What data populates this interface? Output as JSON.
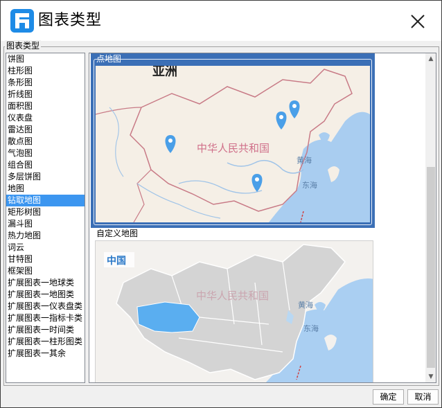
{
  "window": {
    "title": "图表类型",
    "close_icon": "close-icon",
    "logo_icon": "app-logo-icon",
    "accent": "#1e8be6"
  },
  "group": {
    "label": "图表类型"
  },
  "chart_types": [
    {
      "label": "饼图"
    },
    {
      "label": "柱形图"
    },
    {
      "label": "条形图"
    },
    {
      "label": "折线图"
    },
    {
      "label": "面积图"
    },
    {
      "label": "仪表盘"
    },
    {
      "label": "雷达图"
    },
    {
      "label": "散点图"
    },
    {
      "label": "气泡图"
    },
    {
      "label": "组合图"
    },
    {
      "label": "多层饼图"
    },
    {
      "label": "地图"
    },
    {
      "label": "钻取地图"
    },
    {
      "label": "矩形树图"
    },
    {
      "label": "漏斗图"
    },
    {
      "label": "热力地图"
    },
    {
      "label": "词云"
    },
    {
      "label": "甘特图"
    },
    {
      "label": "框架图"
    },
    {
      "label": "扩展图表一地球类"
    },
    {
      "label": "扩展图表一地图类"
    },
    {
      "label": "扩展图表一仪表盘类"
    },
    {
      "label": "扩展图表一指标卡类"
    },
    {
      "label": "扩展图表一时间类"
    },
    {
      "label": "扩展图表一柱形图类"
    },
    {
      "label": "扩展图表一其余"
    }
  ],
  "selected_index": 12,
  "selection_color": "#3c96f0",
  "previews": [
    {
      "label": "点地图",
      "selected": true,
      "map": {
        "continent_label": "亚洲",
        "country_label": "中华人民共和国",
        "sea_labels": [
          "黄海",
          "东海"
        ],
        "marker_icon": "map-pin-icon",
        "marker_color": "#4a9fe8"
      }
    },
    {
      "label": "自定义地图",
      "selected": false,
      "map": {
        "region_label": "中国",
        "country_label": "中华人民共和国",
        "sea_labels": [
          "黄海",
          "东海"
        ],
        "highlight_color": "#5aaef0"
      }
    }
  ],
  "buttons": {
    "ok": "确定",
    "cancel": "取消"
  }
}
